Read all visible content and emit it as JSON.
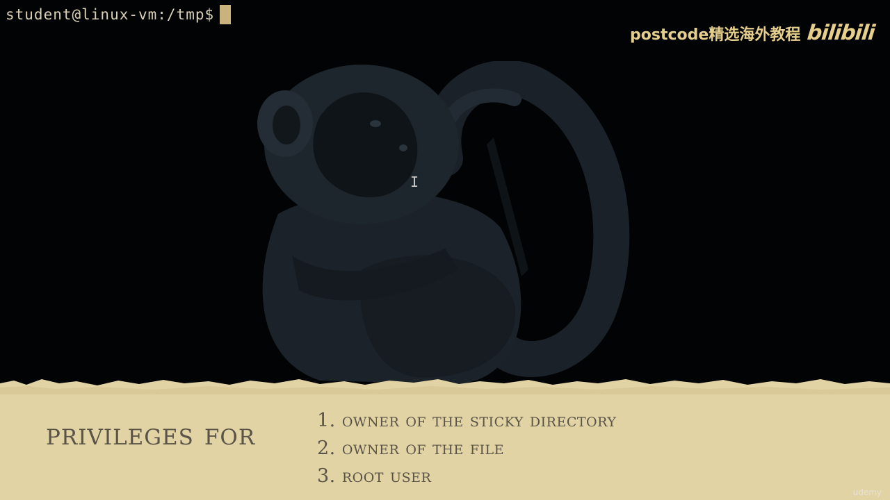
{
  "terminal": {
    "prompt": "student@linux-vm:/tmp$"
  },
  "watermark": {
    "text": "postcode精选海外教程",
    "logo": "bilibili"
  },
  "slide": {
    "title": "privileges for",
    "items": [
      "1. owner of the sticky directory",
      "2. owner of the file",
      "3. root user"
    ]
  },
  "footer": {
    "brand": "udemy"
  },
  "colors": {
    "terminal_bg": "#020304",
    "prompt_text": "#d9d0b8",
    "cursor": "#c9b27c",
    "watermark": "#e6cf8c",
    "paper": "#e1d3a4",
    "ink": "#5a5448"
  },
  "icons": {
    "text_cursor": "I-beam-cursor-icon"
  }
}
